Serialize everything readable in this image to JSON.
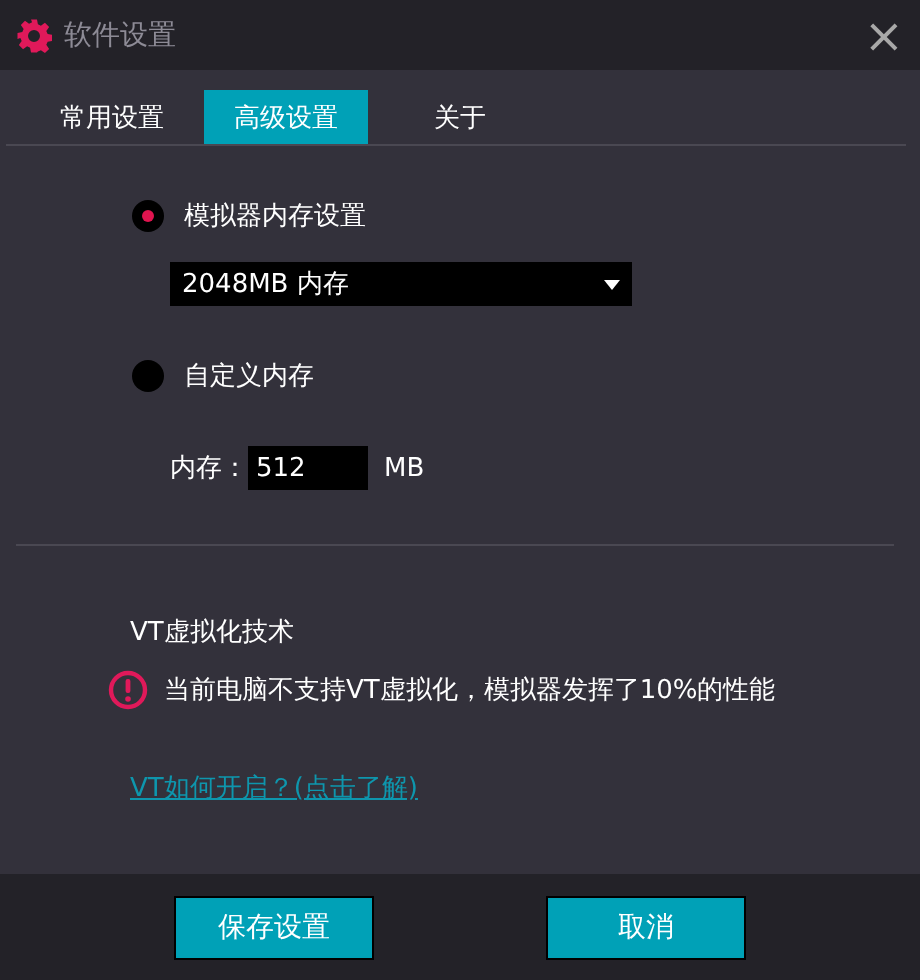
{
  "window": {
    "title": "软件设置",
    "close": "×"
  },
  "tabs": [
    {
      "label": "常用设置",
      "selected": false
    },
    {
      "label": "高级设置",
      "selected": true
    },
    {
      "label": "关于",
      "selected": false
    }
  ],
  "memory": {
    "options": [
      {
        "label": "模拟器内存设置",
        "selected": true
      },
      {
        "label": "自定义内存",
        "selected": false
      }
    ],
    "preset": "2048MB 内存",
    "custom_label": "内存：",
    "custom_value": "512",
    "custom_unit": "MB"
  },
  "vt": {
    "title": "VT虚拟化技术",
    "warning": "当前电脑不支持VT虚拟化，模拟器发挥了10%的性能",
    "link": "VT如何开启？(点击了解)"
  },
  "buttons": [
    "保存设置",
    "取消"
  ]
}
